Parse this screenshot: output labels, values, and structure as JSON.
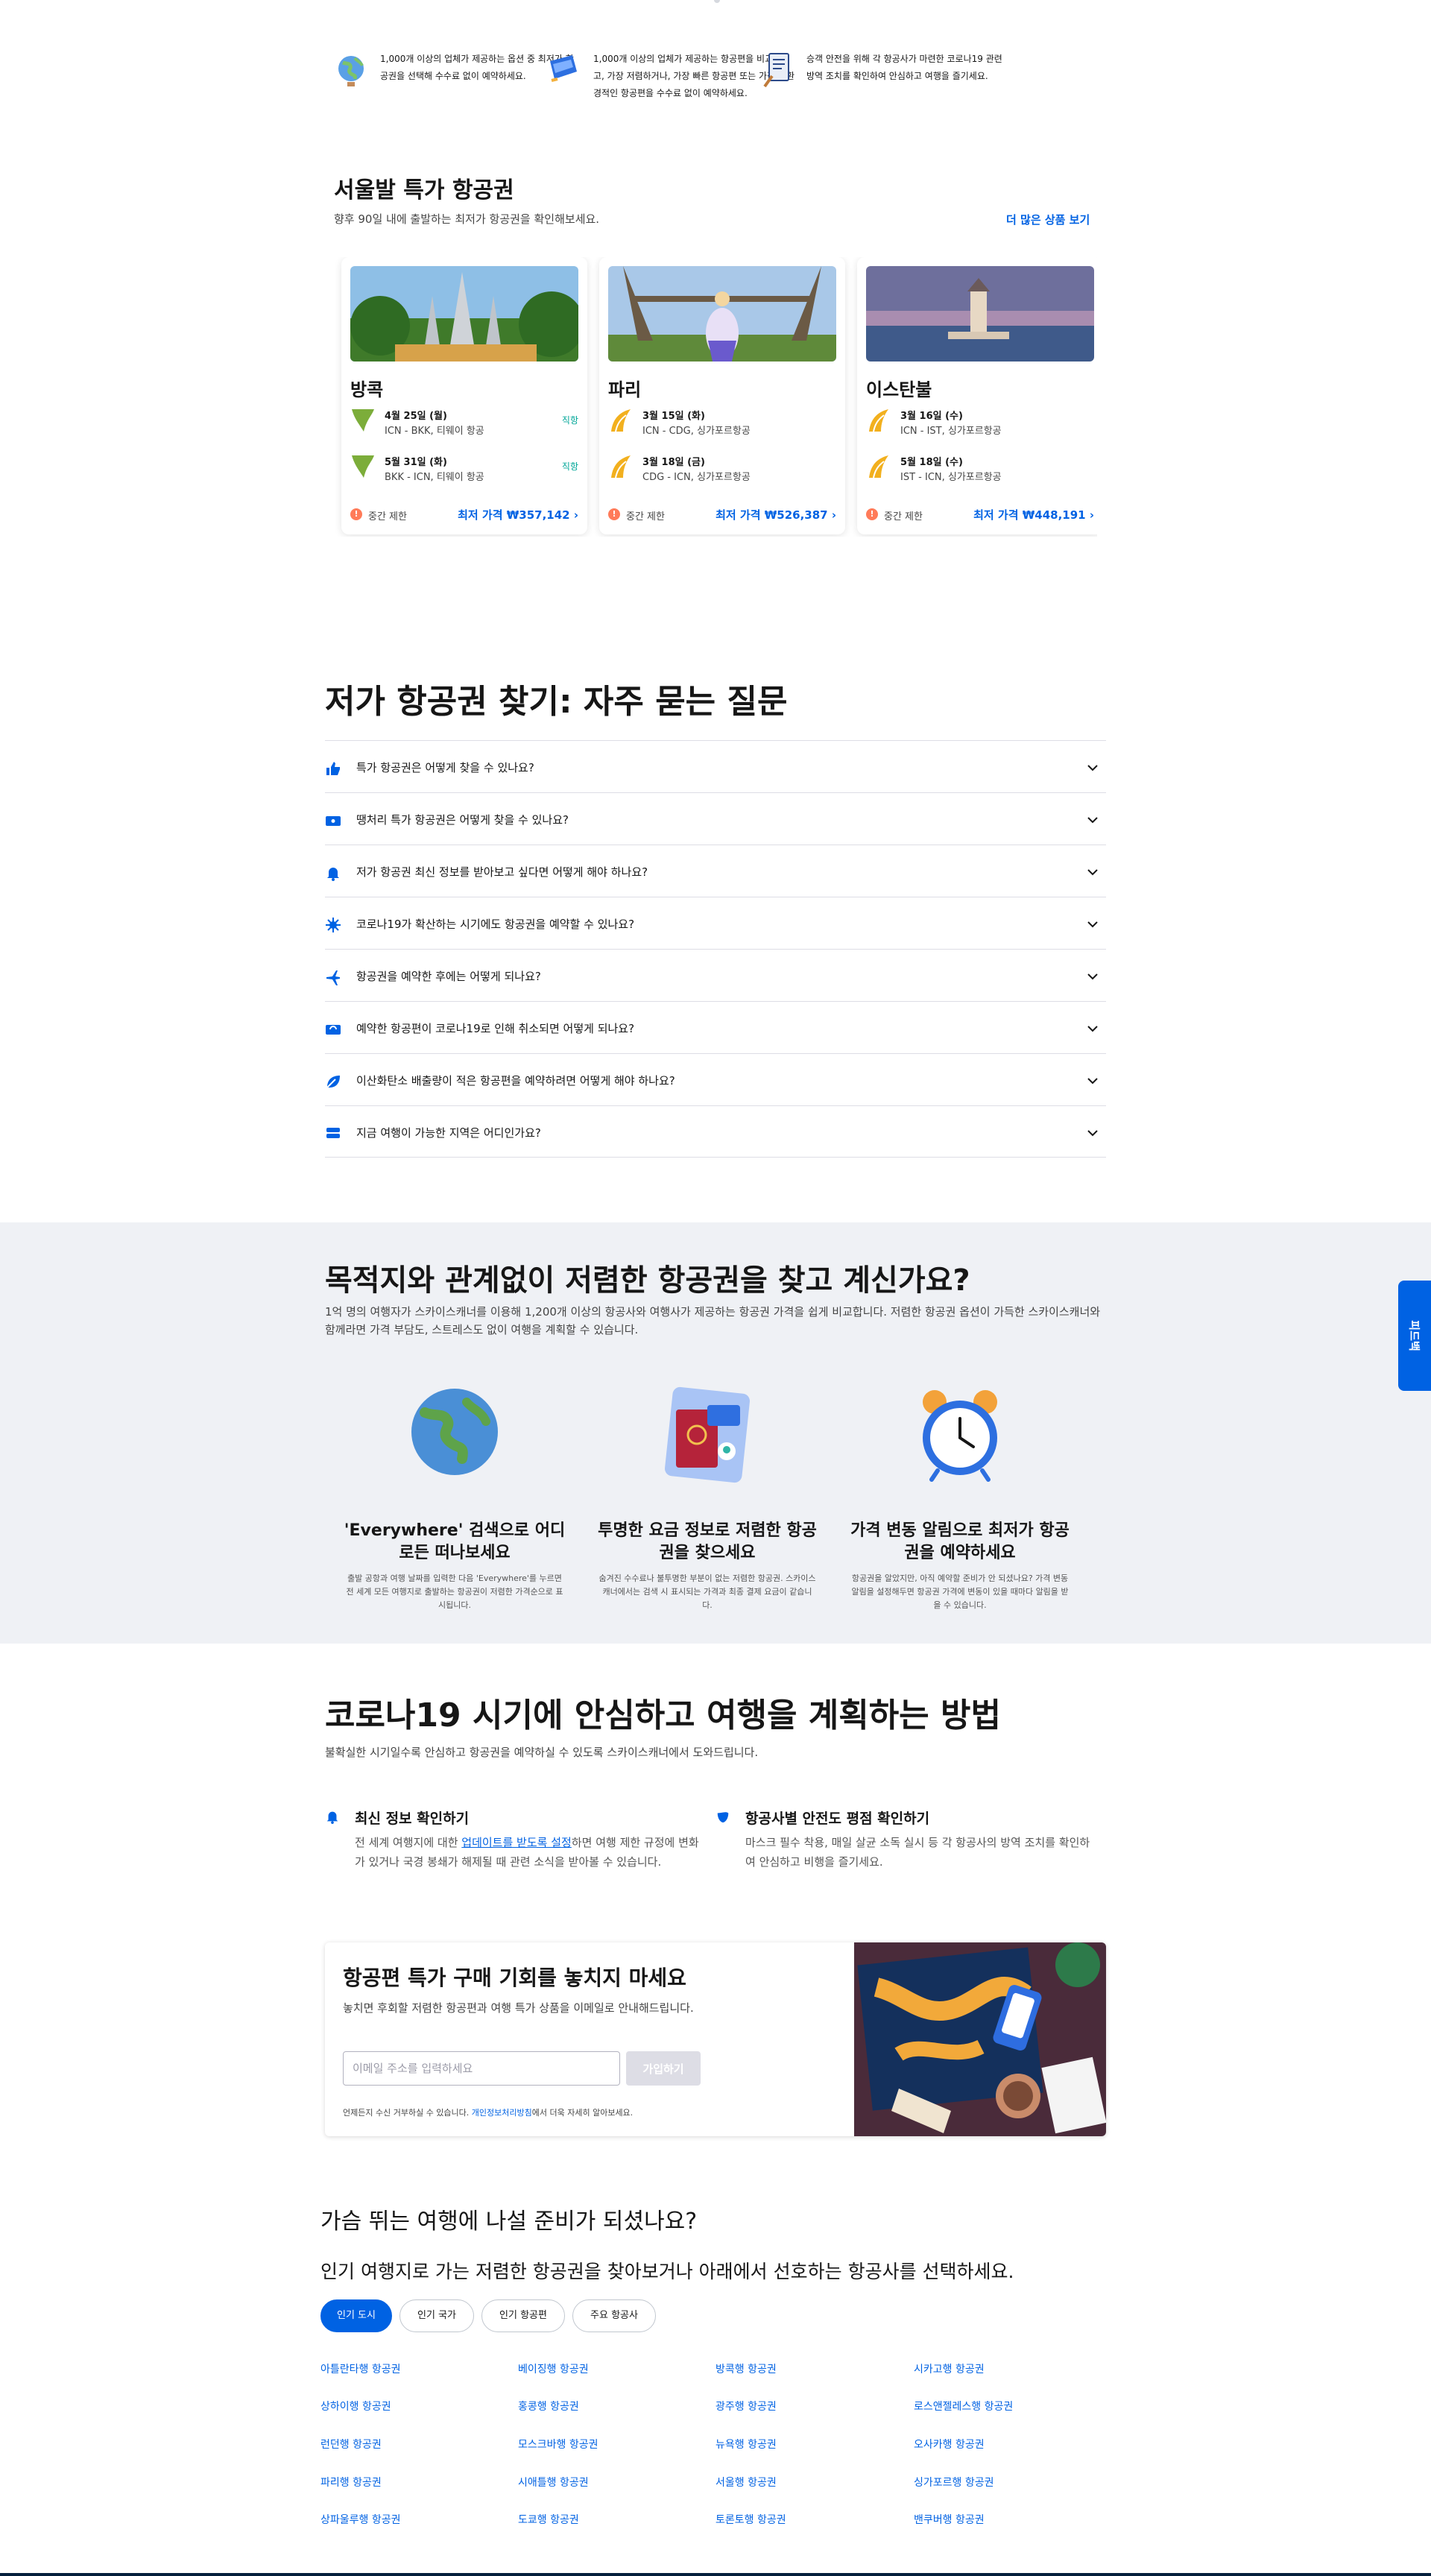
{
  "features": [
    {
      "icon": "globe-icon",
      "text": "1,000개 이상의 업체가 제공하는 옵션 중 최저가 항공권을 선택해 수수료 없이 예약하세요."
    },
    {
      "icon": "flag-icon",
      "text": "1,000개 이상의 업체가 제공하는 항공편을 비교해보고, 가장 저렴하거나, 가장 빠른 항공편 또는 가장 친환경적인 항공편을 수수료 없이 예약하세요."
    },
    {
      "icon": "checklist-icon",
      "text": "승객 안전을 위해 각 항공사가 마련한 코로나19 관련 방역 조치를 확인하여 안심하고 여행을 즐기세요."
    }
  ],
  "deals": {
    "title": "서울발 특가 항공권",
    "subtitle": "향후 90일 내에 출발하는 최저가 항공권을 확인해보세요.",
    "more": "더 많은 상품 보기",
    "cards": [
      {
        "city": "방콕",
        "legs": [
          {
            "date": "4월 25일 (월)",
            "route": "ICN - BKK, 티웨이 항공",
            "direct": "직항",
            "logo_color": "#7cad3a"
          },
          {
            "date": "5월 31일 (화)",
            "route": "BKK - ICN, 티웨이 항공",
            "direct": "직항",
            "logo_color": "#7cad3a"
          }
        ],
        "warn": "중간 제한",
        "price": "최저 가격 ₩357,142"
      },
      {
        "city": "파리",
        "legs": [
          {
            "date": "3월 15일 (화)",
            "route": "ICN - CDG, 싱가포르항공",
            "direct": "",
            "logo_color": "#f2b01e"
          },
          {
            "date": "3월 18일 (금)",
            "route": "CDG - ICN, 싱가포르항공",
            "direct": "",
            "logo_color": "#f2b01e"
          }
        ],
        "warn": "중간 제한",
        "price": "최저 가격 ₩526,387"
      },
      {
        "city": "이스탄불",
        "legs": [
          {
            "date": "3월 16일 (수)",
            "route": "ICN - IST, 싱가포르항공",
            "direct": "",
            "logo_color": "#f2b01e"
          },
          {
            "date": "5월 18일 (수)",
            "route": "IST - ICN, 싱가포르항공",
            "direct": "",
            "logo_color": "#f2b01e"
          }
        ],
        "warn": "중간 제한",
        "price": "최저 가격 ₩448,191"
      }
    ]
  },
  "faq": {
    "title": "저가 항공권 찾기: 자주 묻는 질문",
    "items": [
      {
        "icon": "thumbs-up-icon",
        "question": "특가 항공권은 어떻게 찾을 수 있나요?"
      },
      {
        "icon": "ticket-icon",
        "question": "땡처리 특가 항공권은 어떻게 찾을 수 있나요?"
      },
      {
        "icon": "bell-icon",
        "question": "저가 항공권 최신 정보를 받아보고 싶다면 어떻게 해야 하나요?"
      },
      {
        "icon": "virus-icon",
        "question": "코로나19가 확산하는 시기에도 항공권을 예약할 수 있나요?"
      },
      {
        "icon": "plane-icon",
        "question": "항공권을 예약한 후에는 어떻게 되나요?"
      },
      {
        "icon": "refund-icon",
        "question": "예약한 항공편이 코로나19로 인해 취소되면 어떻게 되나요?"
      },
      {
        "icon": "leaf-icon",
        "question": "이산화탄소 배출량이 적은 항공편을 예약하려면 어떻게 해야 하나요?"
      },
      {
        "icon": "layers-icon",
        "question": "지금 여행이 가능한 지역은 어디인가요?"
      }
    ]
  },
  "band": {
    "title": "목적지와 관계없이 저렴한 항공권을 찾고 계신가요?",
    "desc": "1억 명의 여행자가 스카이스캐너를 이용해 1,200개 이상의 항공사와 여행사가 제공하는 항공권 가격을 쉽게 비교합니다. 저렴한 항공권 옵션이 가득한 스카이스캐너와 함께라면 가격 부담도, 스트레스도 없이 여행을 계획할 수 있습니다.",
    "benefits": [
      {
        "title": "'Everywhere' 검색으로 어디로든 떠나보세요",
        "desc": "출발 공항과 여행 날짜를 입력한 다음 'Everywhere'를 누르면 전 세계 모든 여행지로 출발하는 항공권이 저렴한 가격순으로 표시됩니다."
      },
      {
        "title": "투명한 요금 정보로 저렴한 항공권을 찾으세요",
        "desc": "숨겨진 수수료나 불투명한 부분이 없는 저렴한 항공권. 스카이스캐너에서는 검색 시 표시되는 가격과 최종 결제 요금이 같습니다."
      },
      {
        "title": "가격 변동 알림으로 최저가 항공권을 예약하세요",
        "desc": "항공권을 알았지만, 아직 예약할 준비가 안 되셨나요? 가격 변동 알림을 설정해두면 항공권 가격에 변동이 있을 때마다 알림을 받을 수 있습니다."
      }
    ]
  },
  "covid": {
    "title": "코로나19 시기에 안심하고 여행을 계획하는 방법",
    "subtitle": "불확실한 시기일수록 안심하고 항공권을 예약하실 수 있도록 스카이스캐너에서 도와드립니다.",
    "tips": [
      {
        "title": "최신 정보 확인하기",
        "desc_before": "전 세계 여행지에 대한 ",
        "link": "업데이트를 받도록 설정",
        "desc_after": "하면 여행 제한 규정에 변화가 있거나 국경 봉쇄가 해제될 때 관련 소식을 받아볼 수 있습니다."
      },
      {
        "title": "항공사별 안전도 평점 확인하기",
        "desc": "마스크 필수 착용, 매일 살균 소독 실시 등 각 항공사의 방역 조치를 확인하여 안심하고 비행을 즐기세요."
      }
    ]
  },
  "newsletter": {
    "title": "항공편 특가 구매 기회를 놓치지 마세요",
    "desc": "놓치면 후회할 저렴한 항공편과 여행 특가 상품을 이메일로 안내해드립니다.",
    "placeholder": "이메일 주소를 입력하세요",
    "button": "가입하기",
    "note_before": "언제든지 수신 거부하실 수 있습니다. ",
    "note_link": "개인정보처리방침",
    "note_after": "에서 더욱 자세히 알아보세요."
  },
  "popular": {
    "title": "가슴 뛰는 여행에 나설 준비가 되셨나요?",
    "subtitle": "인기 여행지로 가는 저렴한 항공권을 찾아보거나 아래에서 선호하는 항공사를 선택하세요.",
    "tabs": [
      "인기 도시",
      "인기 국가",
      "인기 항공편",
      "주요 항공사"
    ],
    "links": [
      [
        "아틀란타행 항공권",
        "베이징행 항공권",
        "방콕행 항공권",
        "시카고행 항공권"
      ],
      [
        "상하이행 항공권",
        "홍콩행 항공권",
        "광주행 항공권",
        "로스앤젤레스행 항공권"
      ],
      [
        "런던행 항공권",
        "모스크바행 항공권",
        "뉴욕행 항공권",
        "오사카행 항공권"
      ],
      [
        "파리행 항공권",
        "시애틀행 항공권",
        "서울행 항공권",
        "싱가포르행 항공권"
      ],
      [
        "상파울루행 항공권",
        "도쿄행 항공권",
        "토론토행 항공권",
        "밴쿠버행 항공권"
      ]
    ]
  },
  "feedback": "피드백"
}
